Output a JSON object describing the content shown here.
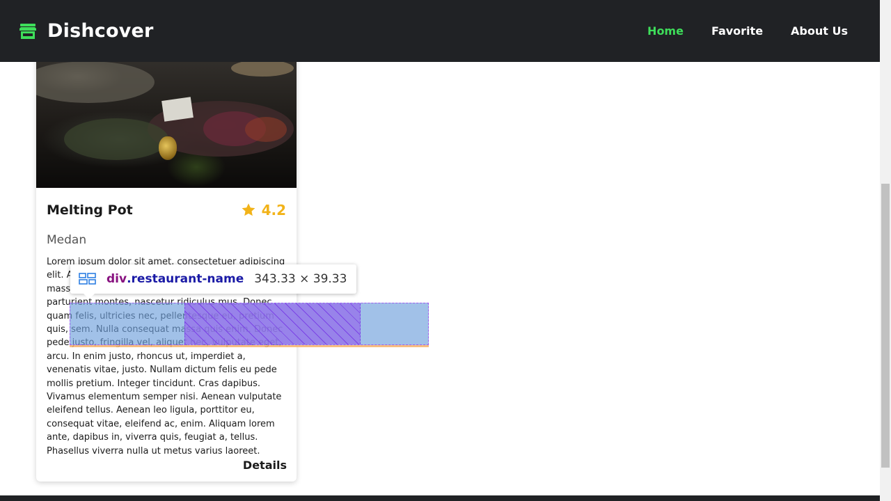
{
  "header": {
    "brand": "Dishcover",
    "nav": [
      {
        "label": "Home",
        "active": true
      },
      {
        "label": "Favorite",
        "active": false
      },
      {
        "label": "About Us",
        "active": false
      }
    ],
    "accent_color": "#3ede5a",
    "background_color": "#202225"
  },
  "card": {
    "name": "Melting Pot",
    "rating": "4.2",
    "city": "Medan",
    "description": "Lorem ipsum dolor sit amet, consectetuer adipiscing elit. Aenean commodo ligula eget dolor. Aenean massa. Cum sociis natoque penatibus et magnis dis parturient montes, nascetur ridiculus mus. Donec quam felis, ultricies nec, pellentesque eu, pretium quis, sem. Nulla consequat massa quis enim. Donec pede justo, fringilla vel, aliquet nec, vulputate eget, arcu. In enim justo, rhoncus ut, imperdiet a, venenatis vitae, justo. Nullam dictum felis eu pede mollis pretium. Integer tincidunt. Cras dapibus. Vivamus elementum semper nisi. Aenean vulputate eleifend tellus. Aenean leo ligula, porttitor eu, consequat vitae, eleifend ac, enim. Aliquam lorem ante, dapibus in, viverra quis, feugiat a, tellus. Phasellus viverra nulla ut metus varius laoreet.",
    "details_label": "Details",
    "rating_color": "#f2b319"
  },
  "devtools_tooltip": {
    "tag": "div",
    "class": ".restaurant-name",
    "size": "343.33 × 39.33"
  },
  "icons": {
    "brand": "store-icon",
    "rating": "star-icon",
    "tooltip": "grid-layout-icon"
  }
}
